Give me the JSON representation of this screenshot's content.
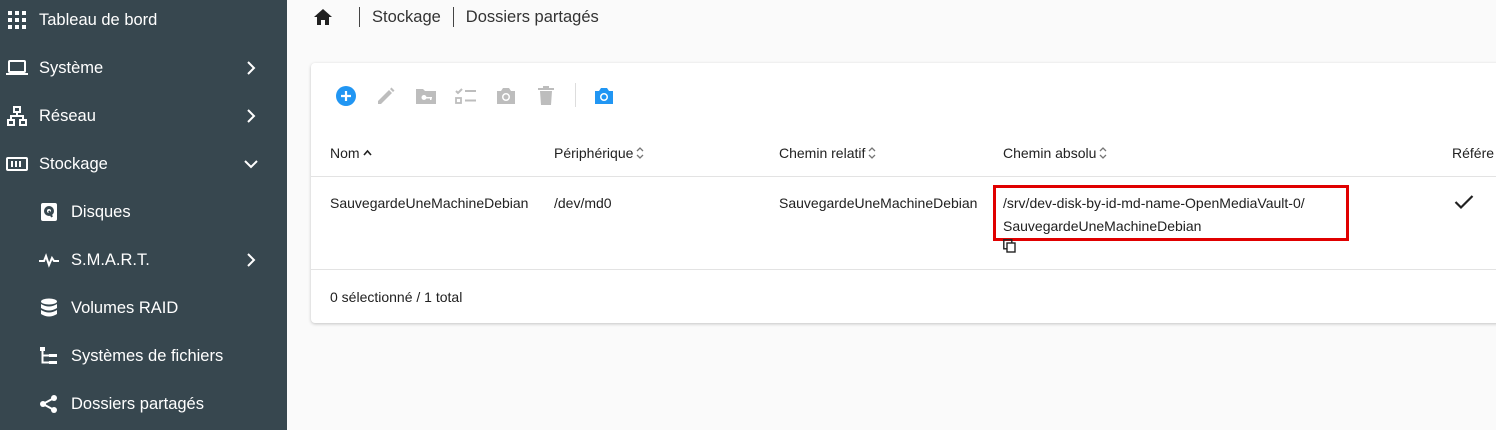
{
  "sidebar": {
    "items": [
      {
        "label": "Tableau de bord",
        "icon": "grid-icon"
      },
      {
        "label": "Système",
        "icon": "laptop-icon"
      },
      {
        "label": "Réseau",
        "icon": "network-icon"
      },
      {
        "label": "Stockage",
        "icon": "storage-icon"
      },
      {
        "label": "Disques",
        "icon": "disk-icon"
      },
      {
        "label": "S.M.A.R.T.",
        "icon": "pulse-icon"
      },
      {
        "label": "Volumes RAID",
        "icon": "database-icon"
      },
      {
        "label": "Systèmes de fichiers",
        "icon": "file-tree-icon"
      },
      {
        "label": "Dossiers partagés",
        "icon": "share-icon"
      }
    ]
  },
  "breadcrumb": {
    "home_icon": "home-icon",
    "items": [
      "Stockage",
      "Dossiers partagés"
    ]
  },
  "toolbar": {
    "buttons": [
      "add-circle-icon",
      "pencil-icon",
      "folder-key-icon",
      "checklist-icon",
      "camera-icon",
      "trash-icon",
      "camera-icon"
    ],
    "accent_color": "#2196f3",
    "disabled_color": "#bdbdbd"
  },
  "table": {
    "columns": [
      "Nom",
      "Périphérique",
      "Chemin relatif",
      "Chemin absolu",
      "Référe"
    ],
    "rows": [
      {
        "name": "SauvegardeUneMachineDebian",
        "device": "/dev/md0",
        "relative_path": "SauvegardeUneMachineDebian",
        "absolute_path_line1": "/srv/dev-disk-by-id-md-name-OpenMediaVault-0/",
        "absolute_path_line2": "SauvegardeUneMachineDebian",
        "referenced": "check-icon"
      }
    ],
    "footer": "0 sélectionné / 1 total"
  },
  "colors": {
    "sidebar_bg": "#37474f",
    "highlight_border": "#e00000"
  }
}
